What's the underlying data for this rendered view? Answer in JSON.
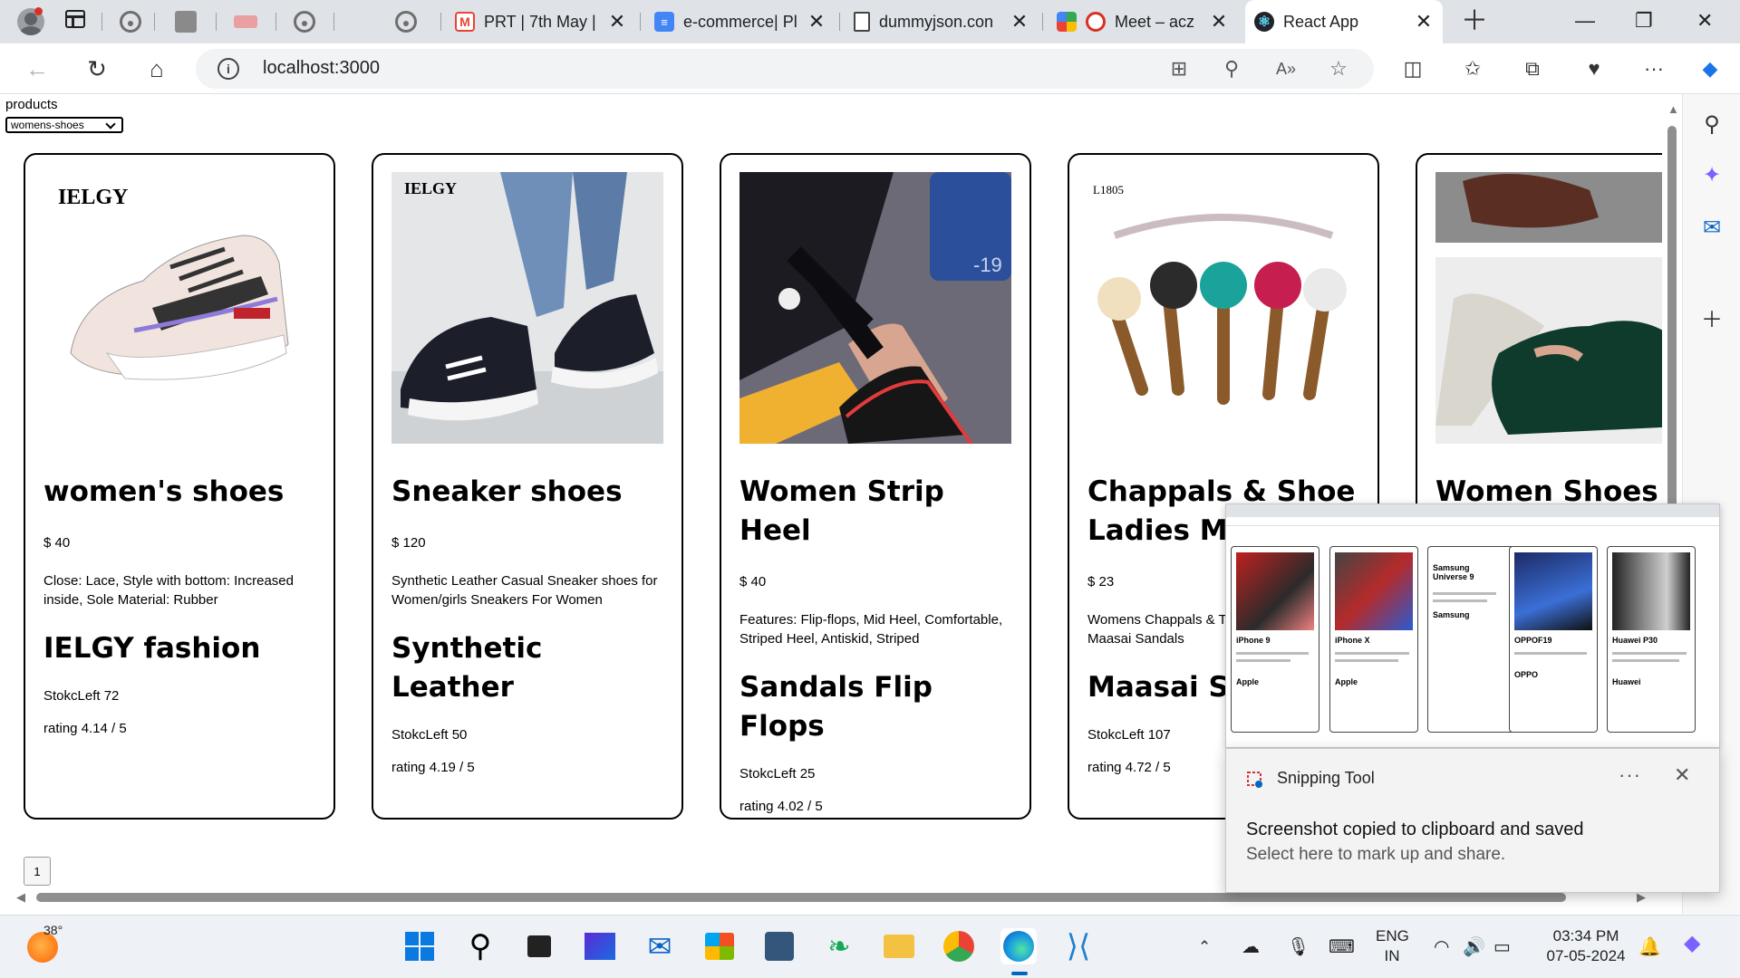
{
  "browser": {
    "tabs": [
      {
        "title": "PRT | 7th May |",
        "favicon": "gmail-icon",
        "color": "#ea4335"
      },
      {
        "title": "e-commerce| Pl",
        "favicon": "docs-icon",
        "color": "#4285f4"
      },
      {
        "title": "dummyjson.con",
        "favicon": "page-icon",
        "color": "#555555"
      },
      {
        "title": "Meet – acz",
        "favicon": "meet-icon",
        "color": "#d93025"
      },
      {
        "title": "React App",
        "favicon": "react-icon",
        "color": "#61dafb",
        "active": true
      }
    ],
    "address": "localhost:3000",
    "accent": "#0067c0"
  },
  "page": {
    "category_label": "products",
    "selected_category": "womens-shoes",
    "page_number": "1"
  },
  "products": [
    {
      "title": "women's shoes",
      "price": "$ 40",
      "description": "Close: Lace, Style with bottom: Increased inside, Sole Material: Rubber",
      "brand": "IELGY fashion",
      "stock": "StokcLeft 72",
      "rating": "rating 4.14 / 5",
      "image_brand_text": "IELGY"
    },
    {
      "title": "Sneaker shoes",
      "price": "$ 120",
      "description": "Synthetic Leather Casual Sneaker shoes for Women/girls Sneakers For Women",
      "brand": "Synthetic Leather",
      "stock": "StokcLeft 50",
      "rating": "rating 4.19 / 5",
      "image_brand_text": "IELGY"
    },
    {
      "title": "Women Strip Heel",
      "price": "$ 40",
      "description": "Features: Flip-flops, Mid Heel, Comfortable, Striped Heel, Antiskid, Striped",
      "brand": "Sandals Flip Flops",
      "stock": "StokcLeft 25",
      "rating": "rating 4.02 / 5",
      "image_brand_text": "-19"
    },
    {
      "title": "Chappals & Shoe Ladies Me",
      "price": "$ 23",
      "description": "Womens Chappals & Tong Thong Sandal Fl Maasai Sandals",
      "brand": "Maasai Sa",
      "stock": "StokcLeft 107",
      "rating": "rating 4.72 / 5",
      "image_brand_text": "L1805"
    },
    {
      "title": "Women Shoes",
      "price": "",
      "description": "",
      "brand": "",
      "stock": "",
      "rating": "",
      "image_brand_text": ""
    }
  ],
  "preview_products": [
    {
      "title": "iPhone 9",
      "brand": "Apple"
    },
    {
      "title": "iPhone X",
      "brand": "Apple"
    },
    {
      "title": "Samsung Universe 9",
      "brand": "Samsung"
    },
    {
      "title": "OPPOF19",
      "brand": "OPPO"
    },
    {
      "title": "Huawei P30",
      "brand": "Huawei"
    }
  ],
  "toast": {
    "app": "Snipping Tool",
    "more": "···",
    "close": "✕",
    "title": "Screenshot copied to clipboard and saved",
    "subtitle": "Select here to mark up and share."
  },
  "taskbar": {
    "temperature": "38°",
    "language_top": "ENG",
    "language_bottom": "IN",
    "time": "03:34 PM",
    "date": "07-05-2024"
  }
}
